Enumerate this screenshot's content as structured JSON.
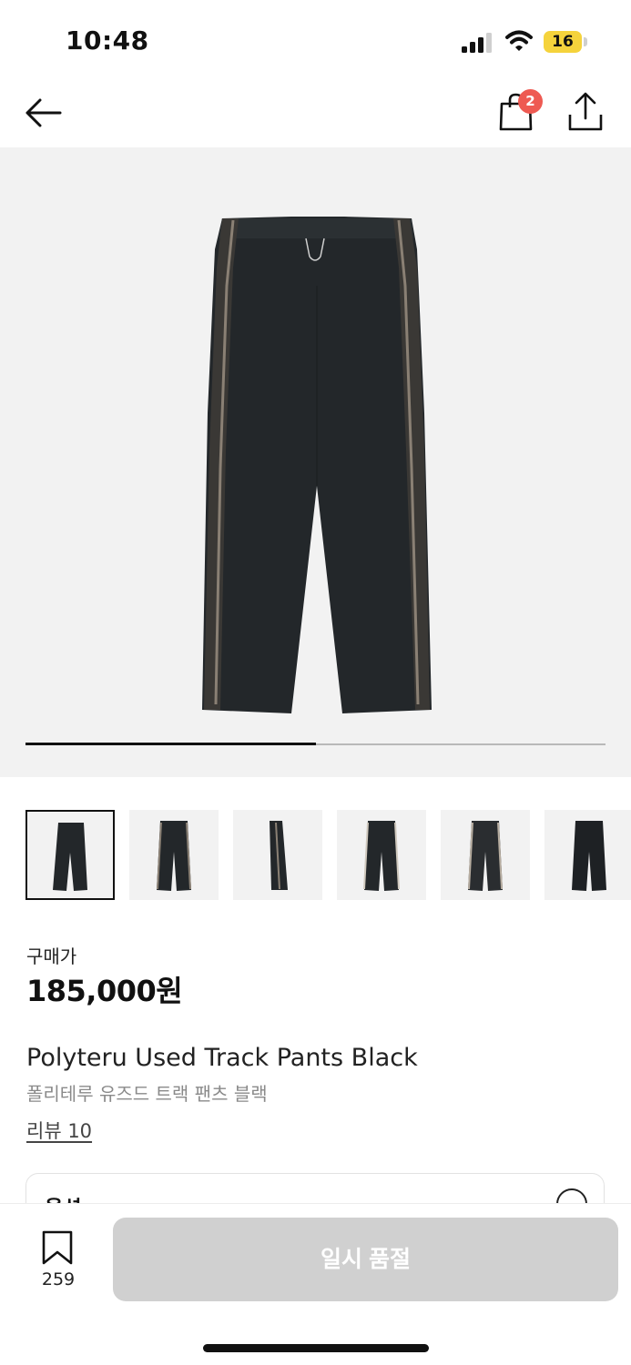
{
  "status_bar": {
    "time": "10:48",
    "battery": "16"
  },
  "nav": {
    "cart_count": "2"
  },
  "gallery": {
    "progress_fraction": 0.5
  },
  "product": {
    "price_label": "구매가",
    "price": "185,000원",
    "name_en": "Polyteru Used Track Pants Black",
    "name_ko": "폴리테루 유즈드 트랙 팬츠 블랙",
    "reviews": "리뷰 10",
    "option_label": "옵션"
  },
  "bottom": {
    "bookmark_count": "259",
    "soldout_label": "일시 품절"
  },
  "icons": [
    "back-arrow-icon",
    "shopping-bag-icon",
    "share-icon",
    "bookmark-icon",
    "signal-icon",
    "wifi-icon",
    "battery-icon",
    "expand-icon"
  ],
  "colors": {
    "badge": "#ee5a52",
    "battery": "#f5d33c",
    "soldout_bg": "#d0d0d0",
    "hero_bg": "#f2f2f2"
  }
}
